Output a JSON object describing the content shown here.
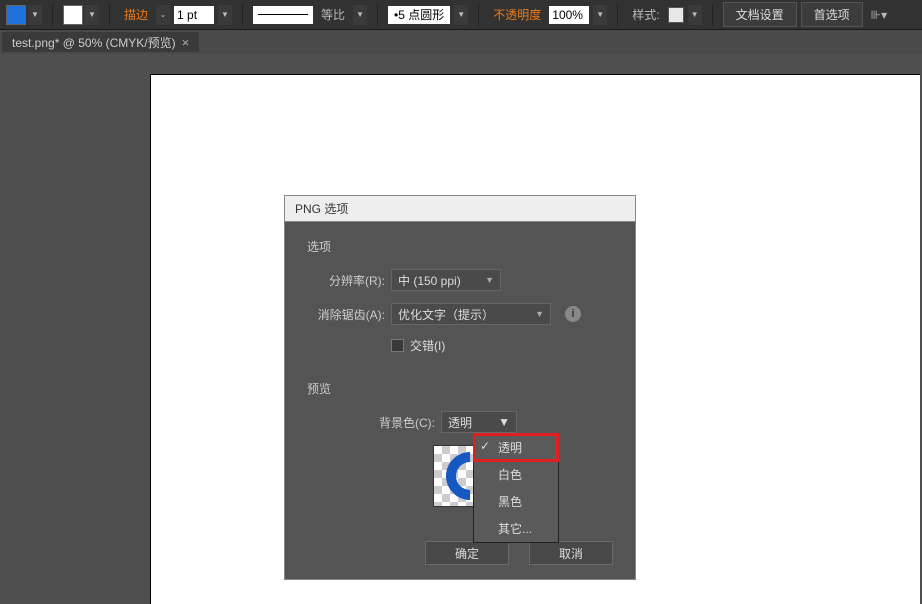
{
  "toolbar": {
    "stroke_label": "描边",
    "stroke_weight": "1 pt",
    "dash_label": "等比",
    "brush_label": "5 点圆形",
    "opacity_label": "不透明度",
    "opacity_value": "100%",
    "style_label": "样式:",
    "doc_setup": "文档设置",
    "prefs": "首选项"
  },
  "tab": {
    "title": "test.png* @ 50% (CMYK/预览)"
  },
  "dialog": {
    "title": "PNG 选项",
    "options_section": "选项",
    "resolution_label": "分辨率(R):",
    "resolution_value": "中 (150 ppi)",
    "antialias_label": "消除锯齿(A):",
    "antialias_value": "优化文字（提示）",
    "interlace_label": "交错(I)",
    "preview_section": "预览",
    "bgcolor_label": "背景色(C):",
    "bgcolor_value": "透明",
    "bg_options": {
      "transparent": "透明",
      "white": "白色",
      "black": "黑色",
      "other": "其它..."
    },
    "ok": "确定",
    "cancel": "取消"
  }
}
